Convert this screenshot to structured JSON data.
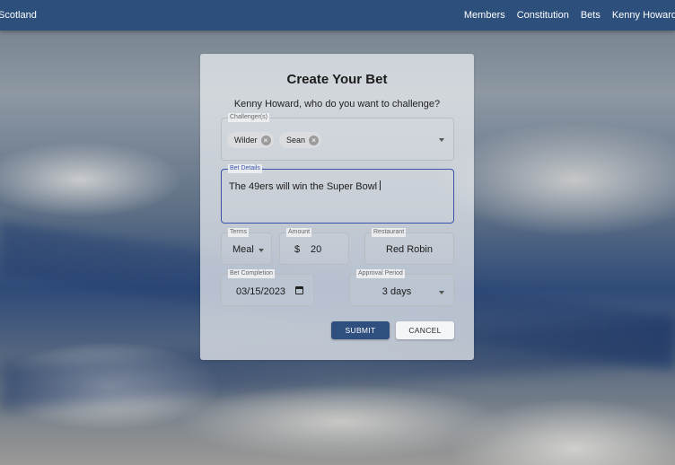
{
  "navbar": {
    "brand": "Scotland",
    "links": [
      "Members",
      "Constitution",
      "Bets",
      "Kenny Howard"
    ]
  },
  "form": {
    "title": "Create Your Bet",
    "subtitle": "Kenny Howard, who do you want to challenge?",
    "challengers": {
      "label": "Challenger(s)",
      "chips": [
        "Wilder",
        "Sean"
      ]
    },
    "bet_details": {
      "label": "Bet Details",
      "value": "The 49ers will win the Super Bowl"
    },
    "terms": {
      "label": "Terms",
      "value": "Meal"
    },
    "amount": {
      "label": "Amount",
      "currency": "$",
      "value": "20"
    },
    "restaurant": {
      "label": "Restaurant",
      "value": "Red Robin"
    },
    "bet_completion": {
      "label": "Bet Completion",
      "value": "03/15/2023"
    },
    "approval_period": {
      "label": "Approval Period",
      "value": "3 days"
    },
    "submit_label": "SUBMIT",
    "cancel_label": "CANCEL"
  },
  "colors": {
    "navbar": "#2c4f7c",
    "submit": "#2f4f7f",
    "focus": "#3a52a8"
  }
}
